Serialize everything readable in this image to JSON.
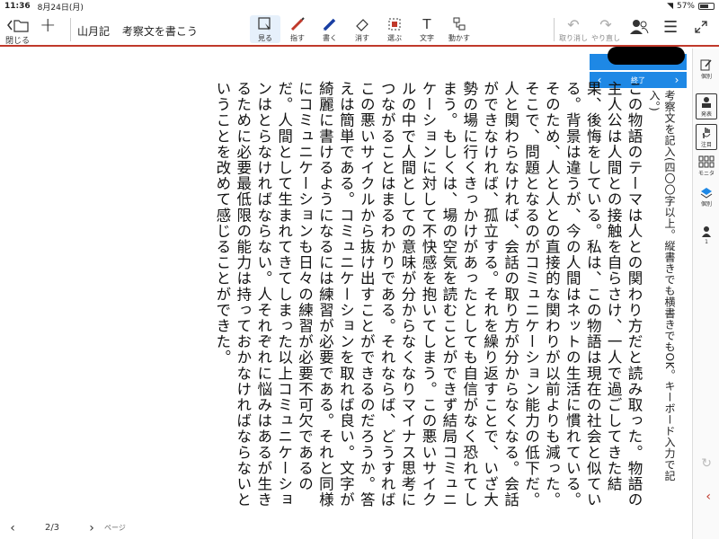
{
  "status_bar": {
    "time": "11:36",
    "date": "8月24日(月)",
    "battery": "57%"
  },
  "toolbar": {
    "close_label": "閉じる",
    "title_prefix": "山月記",
    "title": "考察文を書こう",
    "tools": [
      {
        "label": "見る",
        "icon": "view-icon"
      },
      {
        "label": "指す",
        "icon": "pointer-pen-icon"
      },
      {
        "label": "書く",
        "icon": "pen-icon"
      },
      {
        "label": "消す",
        "icon": "eraser-icon"
      },
      {
        "label": "選ぶ",
        "icon": "select-icon"
      },
      {
        "label": "文字",
        "icon": "text-icon"
      },
      {
        "label": "動かす",
        "icon": "move-icon"
      }
    ],
    "undo_label": "取り消し",
    "redo_label": "やり直し"
  },
  "presenter": {
    "end_label": "終了"
  },
  "prompt_text": "考察文を記入(四〇〇字以上。縦書きでも横書きでもOK。キーボード入力で記入。)",
  "essay_text": "この物語のテーマは人との関わり方だと読み取った。物語の主人公は人間との接触を自らさけ、一人で過ごしてきた結果、後悔をしている。私は、この物語は現在の社会と似ている。背景は違うが、今の人間はネットの生活に慣れている。そのため、人と人との直接的な関わりが以前よりも減った。そこで、問題となるのがコミュニケーション能力の低下だ。人と関わらなければ、会話の取り方が分からなくなる。会話ができなければ、孤立する。それを繰り返すことで、いざ大勢の場に行くきっかけがあったとしても自信がなく恐れてしまう。もしくは、場の空気を読むことができず結局コミュニケーションに対して不快感を抱いてしまう。この悪いサイクルの中で人間としての意味が分からなくなりマイナス思考につながることはまるわかりである。それならば、どうすればこの悪いサイクルから抜け出すことができるのだろうか。答えは簡単である。コミュニケーションを取れば良い。文字が綺麗に書けるようになるには練習が必要である。それと同様にコミュニケーションも日々の練習が必要不可欠であるのだ。人間として生まれてきてしまった以上コミュニケーションはとらなければならない。人それぞれに悩みはあるが生きるために必要最低限の能力は持っておかなければならないということを改めて感じることができた。",
  "right_panel": [
    {
      "label": "個別",
      "icon": "edit-note-icon"
    },
    {
      "label": "発表",
      "icon": "presenter-icon"
    },
    {
      "label": "注目",
      "icon": "raise-hand-icon"
    },
    {
      "label": "モニタ",
      "icon": "monitor-grid-icon"
    },
    {
      "label": "個別",
      "icon": "layers-icon"
    },
    {
      "label": "1",
      "icon": "person-icon"
    }
  ],
  "pager": {
    "page": "2/3",
    "label": "ページ"
  },
  "colors": {
    "accent_red": "#c0392b",
    "presenter_blue": "#1e88e5"
  }
}
